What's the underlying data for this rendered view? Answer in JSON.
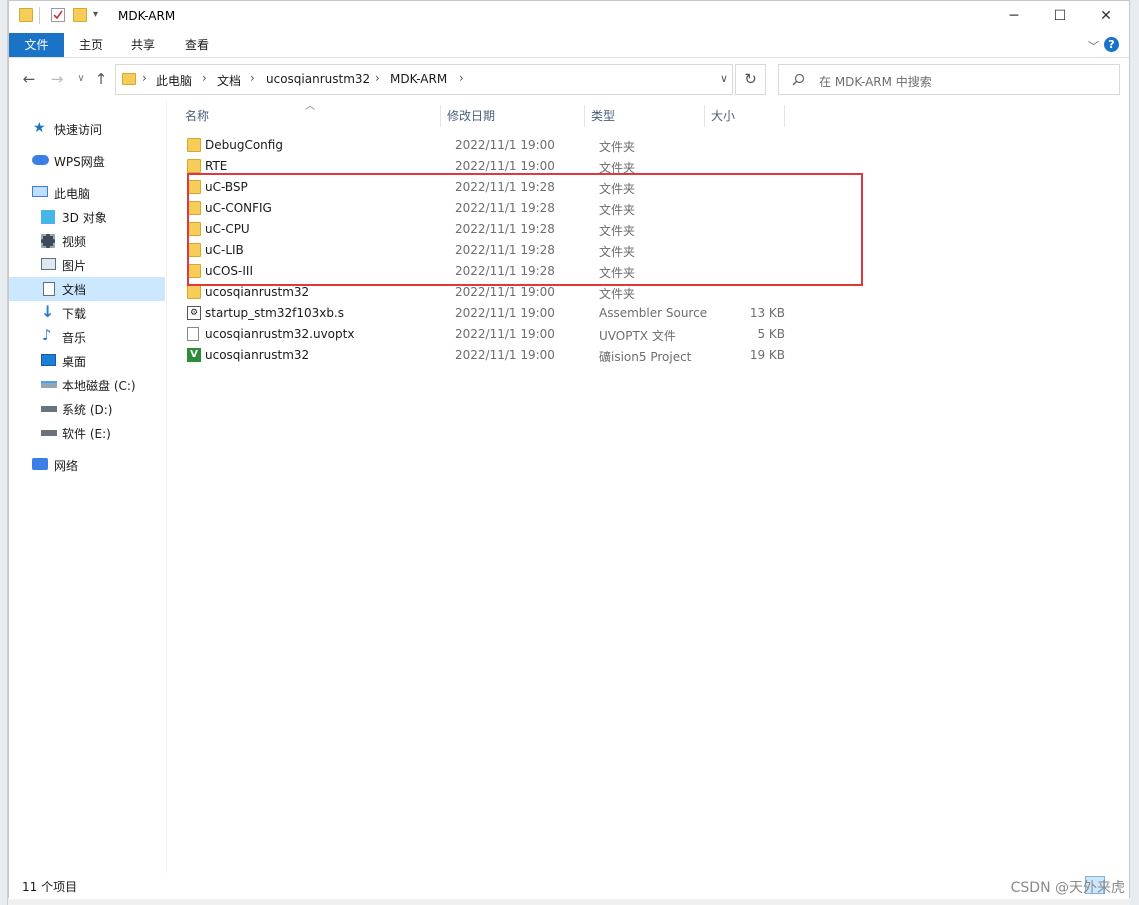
{
  "window": {
    "title": "MDK-ARM",
    "controls": {
      "minimize": "─",
      "maximize": "☐",
      "close": "✕"
    }
  },
  "ribbon": {
    "tabs": [
      "文件",
      "主页",
      "共享",
      "查看"
    ],
    "help": "?"
  },
  "address": {
    "breadcrumb": [
      "此电脑",
      "文档",
      "ucosqianrustm32",
      "MDK-ARM"
    ],
    "separator": "›"
  },
  "search": {
    "placeholder": "在 MDK-ARM 中搜索"
  },
  "nav": {
    "items": [
      {
        "label": "快速访问",
        "icon": "star-icon"
      },
      {
        "label": "WPS网盘",
        "icon": "cloud-icon"
      },
      {
        "label": "此电脑",
        "icon": "computer-icon"
      },
      {
        "label": "3D 对象",
        "icon": "cube-icon"
      },
      {
        "label": "视频",
        "icon": "video-icon"
      },
      {
        "label": "图片",
        "icon": "picture-icon"
      },
      {
        "label": "文档",
        "icon": "document-icon"
      },
      {
        "label": "下载",
        "icon": "download-icon"
      },
      {
        "label": "音乐",
        "icon": "music-icon"
      },
      {
        "label": "桌面",
        "icon": "desktop-icon"
      },
      {
        "label": "本地磁盘 (C:)",
        "icon": "drive-icon"
      },
      {
        "label": "系统 (D:)",
        "icon": "drive-icon"
      },
      {
        "label": "软件 (E:)",
        "icon": "drive-icon"
      },
      {
        "label": "网络",
        "icon": "network-icon"
      }
    ],
    "selected": "文档"
  },
  "columns": [
    "名称",
    "修改日期",
    "类型",
    "大小"
  ],
  "files": [
    {
      "name": "DebugConfig",
      "date": "2022/11/1 19:00",
      "type": "文件夹",
      "size": "",
      "icon": "folder-icon"
    },
    {
      "name": "RTE",
      "date": "2022/11/1 19:00",
      "type": "文件夹",
      "size": "",
      "icon": "folder-icon"
    },
    {
      "name": "uC-BSP",
      "date": "2022/11/1 19:28",
      "type": "文件夹",
      "size": "",
      "icon": "folder-icon"
    },
    {
      "name": "uC-CONFIG",
      "date": "2022/11/1 19:28",
      "type": "文件夹",
      "size": "",
      "icon": "folder-icon"
    },
    {
      "name": "uC-CPU",
      "date": "2022/11/1 19:28",
      "type": "文件夹",
      "size": "",
      "icon": "folder-icon"
    },
    {
      "name": "uC-LIB",
      "date": "2022/11/1 19:28",
      "type": "文件夹",
      "size": "",
      "icon": "folder-icon"
    },
    {
      "name": "uCOS-III",
      "date": "2022/11/1 19:28",
      "type": "文件夹",
      "size": "",
      "icon": "folder-icon"
    },
    {
      "name": "ucosqianrustm32",
      "date": "2022/11/1 19:00",
      "type": "文件夹",
      "size": "",
      "icon": "folder-icon"
    },
    {
      "name": "startup_stm32f103xb.s",
      "date": "2022/11/1 19:00",
      "type": "Assembler Source",
      "size": "13 KB",
      "icon": "assembly-file-icon"
    },
    {
      "name": "ucosqianrustm32.uvoptx",
      "date": "2022/11/1 19:00",
      "type": "UVOPTX 文件",
      "size": "5 KB",
      "icon": "file-icon"
    },
    {
      "name": "ucosqianrustm32",
      "date": "2022/11/1 19:00",
      "type": "礦ision5 Project",
      "size": "19 KB",
      "icon": "keil-project-icon"
    }
  ],
  "status": {
    "count": "11 个项目"
  },
  "watermark": "CSDN @天外来虎",
  "colors": {
    "accent": "#1a73c6",
    "highlight": "#e0383b",
    "folder": "#f6cd58"
  }
}
